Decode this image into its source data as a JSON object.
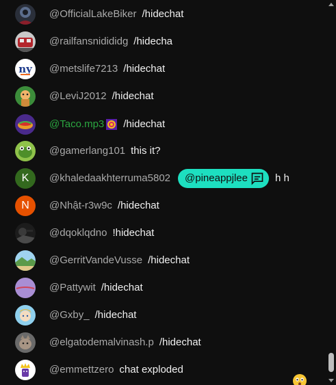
{
  "messages": [
    {
      "author": "@OfficialLakeBiker",
      "text": "/hidechat",
      "avatar": "avatar-biker"
    },
    {
      "author": "@railfansnidididg",
      "text": "/hidecha",
      "avatar": "avatar-train"
    },
    {
      "author": "@metslife7213",
      "text": "/hidechat",
      "avatar": "avatar-mets"
    },
    {
      "author": "@LeviJ2012",
      "text": "/hidechat",
      "avatar": "avatar-cartoon"
    },
    {
      "author": "@Taco.mp3",
      "text": "/hidechat",
      "avatar": "avatar-taco",
      "member": true
    },
    {
      "author": "@gamerlang101",
      "text": "this it?",
      "avatar": "avatar-frog"
    },
    {
      "author": "@khaledaakhterruma5802",
      "mention": "@pineappjlee",
      "text": "h h",
      "avatar": "avatar-letter",
      "letter": "K",
      "avatar_color": "#33691e"
    },
    {
      "author": "@Nhật-r3w9c",
      "text": "/hidechat",
      "avatar": "avatar-letter",
      "letter": "N",
      "avatar_color": "#e65100"
    },
    {
      "author": "@dqoklqdno",
      "text": "!hidechat",
      "avatar": "avatar-dark"
    },
    {
      "author": "@GerritVandeVusse",
      "text": "/hidechat",
      "avatar": "avatar-landscape"
    },
    {
      "author": "@Pattywit",
      "text": "/hidechat",
      "avatar": "avatar-purple"
    },
    {
      "author": "@Gxby_",
      "text": "/hidechat",
      "avatar": "avatar-anime"
    },
    {
      "author": "@elgatodemalvinash.p",
      "text": "/hidechat",
      "avatar": "avatar-cat"
    },
    {
      "author": "@emmettzero",
      "text": "chat exploded",
      "avatar": "avatar-crown"
    }
  ],
  "colors": {
    "background": "#0f0f0f",
    "author": "#aaaaaa",
    "member_author": "#2ba640",
    "message": "#f1f1f1",
    "mention_chip": "#1ddfc0"
  },
  "icons": {
    "member_badge": "member-badge-icon",
    "mention_chat": "chat-bubble-icon",
    "floating_reaction": "surprised-face-emoji"
  }
}
